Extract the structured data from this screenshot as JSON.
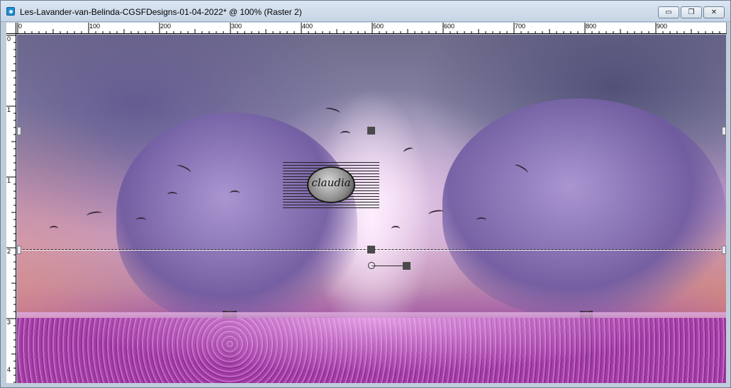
{
  "window": {
    "title": "Les-Lavander-van-Belinda-CGSFDesigns-01-04-2022* @ 100% (Raster 2)",
    "buttons": {
      "minimize_icon": "minimize-icon",
      "minimize_glyph": "▭",
      "restore_icon": "restore-icon",
      "restore_glyph": "❐",
      "close_icon": "close-icon",
      "close_glyph": "✕"
    }
  },
  "ruler_top": {
    "labels": [
      "0",
      "100",
      "200",
      "300",
      "400",
      "500",
      "600",
      "700",
      "800",
      "900"
    ]
  },
  "ruler_left": {
    "labels": [
      "0",
      "1",
      "1",
      "2",
      "3",
      "4"
    ]
  },
  "canvas": {
    "layer": "Raster 2",
    "zoom": "100%",
    "watermark_text": "claudia"
  },
  "colors": {
    "title_bar": "#c6d5e5",
    "window_frame": "#bfcddb",
    "handle": "#4a4a4a",
    "ruler": "#ffffff"
  }
}
